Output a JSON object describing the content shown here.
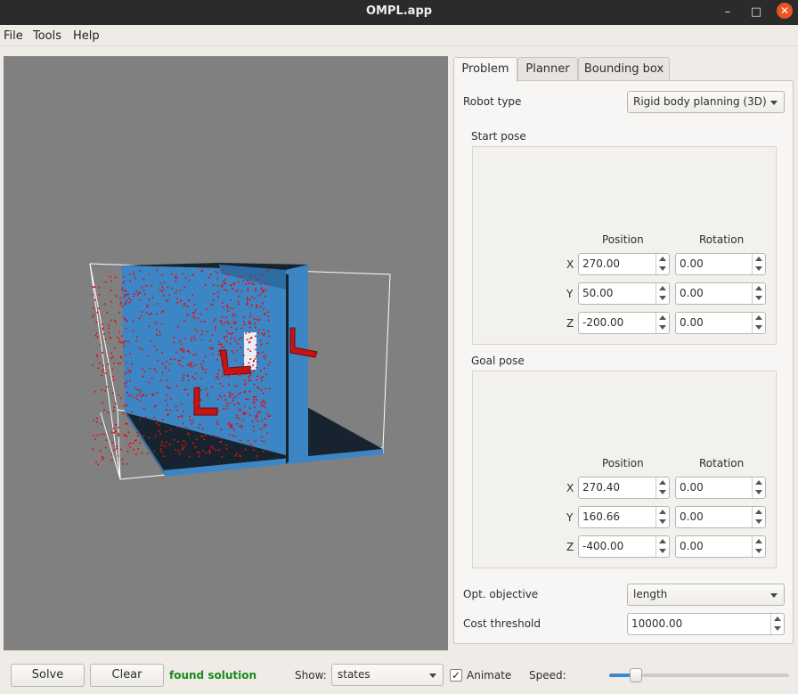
{
  "window": {
    "title": "OMPL.app",
    "minimize_glyph": "–",
    "maximize_glyph": "□",
    "close_glyph": "✕"
  },
  "menu": {
    "file": "File",
    "tools": "Tools",
    "help": "Help"
  },
  "tabs": {
    "problem": "Problem",
    "planner": "Planner",
    "bounding_box": "Bounding box"
  },
  "problem": {
    "robot_type_label": "Robot type",
    "robot_type_value": "Rigid body planning (3D)",
    "start_pose": {
      "title": "Start pose",
      "position_header": "Position",
      "rotation_header": "Rotation",
      "x_label": "X",
      "y_label": "Y",
      "z_label": "Z",
      "x_pos": "270.00",
      "y_pos": "50.00",
      "z_pos": "-200.00",
      "x_rot": "0.00",
      "y_rot": "0.00",
      "z_rot": "0.00"
    },
    "goal_pose": {
      "title": "Goal pose",
      "position_header": "Position",
      "rotation_header": "Rotation",
      "x_label": "X",
      "y_label": "Y",
      "z_label": "Z",
      "x_pos": "270.40",
      "y_pos": "160.66",
      "z_pos": "-400.00",
      "x_rot": "0.00",
      "y_rot": "0.00",
      "z_rot": "0.00"
    },
    "opt_objective_label": "Opt. objective",
    "opt_objective_value": "length",
    "cost_threshold_label": "Cost threshold",
    "cost_threshold_value": "10000.00"
  },
  "bottom": {
    "solve_label": "Solve",
    "clear_label": "Clear",
    "status_text": "found solution",
    "status_color": "#1a8a1a",
    "show_label": "Show:",
    "show_value": "states",
    "animate_label": "Animate",
    "animate_checked": true,
    "check_glyph": "✓",
    "speed_label": "Speed:",
    "speed_fraction": 0.12
  },
  "colors": {
    "viewport_bg": "#808080",
    "obstacle": "#3d86c6",
    "floor": "#17242f",
    "robot": "#c41414",
    "states": "#e01010"
  },
  "icons": {
    "dropdown": "chevron-down-icon",
    "spin_up": "spin-up-icon",
    "spin_down": "spin-down-icon"
  }
}
